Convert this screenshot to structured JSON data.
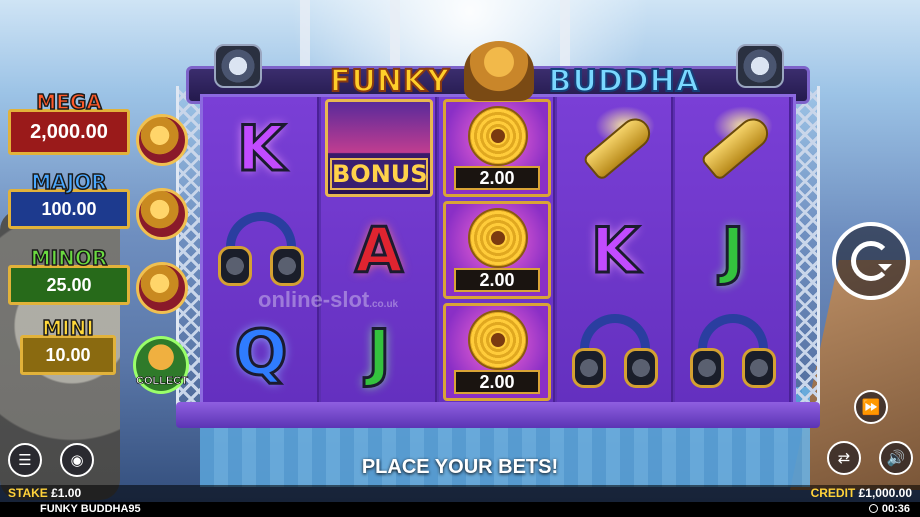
{
  "game": {
    "title_left": "FUNKY",
    "title_right": "BUDDHA",
    "name_footer": "FUNKY BUDDHA95",
    "clock": "00:36",
    "message": "PLACE YOUR BETS!",
    "watermark": "online-slot",
    "watermark_suffix": ".co.uk"
  },
  "jackpots": [
    {
      "label": "MEGA",
      "value": "2,000.00"
    },
    {
      "label": "MAJOR",
      "value": "100.00"
    },
    {
      "label": "MINOR",
      "value": "25.00"
    },
    {
      "label": "MINI",
      "value": "10.00"
    }
  ],
  "collect_label": "COLLECT",
  "bonus_label": "BONUS",
  "reels": [
    [
      "K",
      "headphones",
      "Q"
    ],
    [
      "bonus",
      "A",
      "J"
    ],
    [
      "disc",
      "disc",
      "disc"
    ],
    [
      "champagne",
      "K",
      "headphones"
    ],
    [
      "champagne",
      "J",
      "headphones"
    ]
  ],
  "disc_values": [
    "2.00",
    "2.00",
    "2.00"
  ],
  "footer": {
    "stake_label": "STAKE",
    "stake_value": "£1.00",
    "credit_label": "CREDIT",
    "credit_value": "£1,000.00"
  },
  "icons": {
    "menu": "menu-icon",
    "coins": "coins-icon",
    "autoplay": "autoplay-icon",
    "sound": "sound-icon",
    "turbo": "turbo-icon",
    "spin": "spin-icon"
  }
}
